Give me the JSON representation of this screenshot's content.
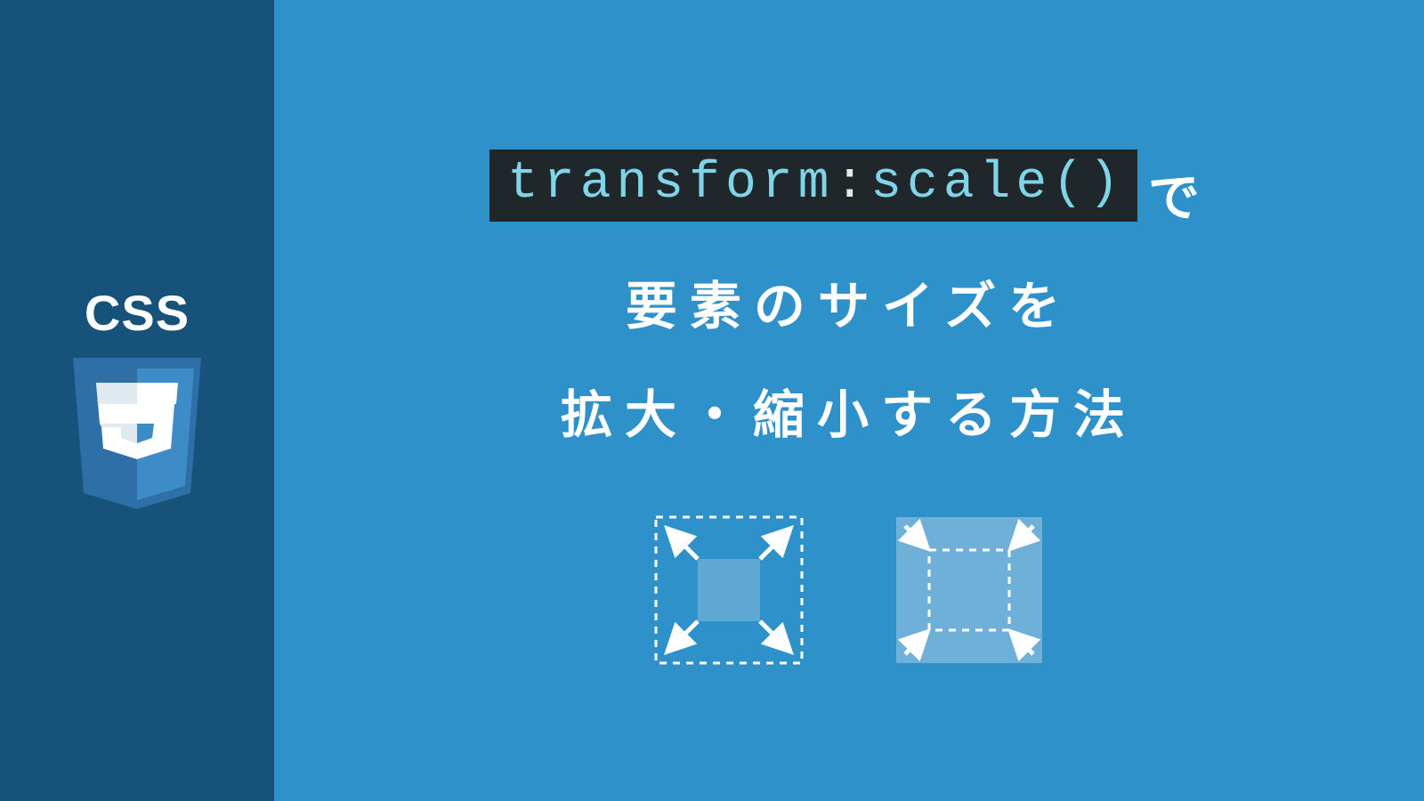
{
  "sidebar": {
    "label": "CSS",
    "logo_alt": "css3-shield-icon"
  },
  "title": {
    "code_property": "transform",
    "code_colon": ":",
    "code_function": "scale()",
    "line1_suffix": "で",
    "line2": "要素のサイズを",
    "line3": "拡大・縮小する方法"
  },
  "diagrams": {
    "expand_alt": "scale-expand-icon",
    "shrink_alt": "scale-shrink-icon"
  },
  "colors": {
    "sidebar_bg": "#16527a",
    "main_bg": "#2e91c9",
    "code_bg": "#20272b",
    "code_fg": "#7fd4e8"
  }
}
